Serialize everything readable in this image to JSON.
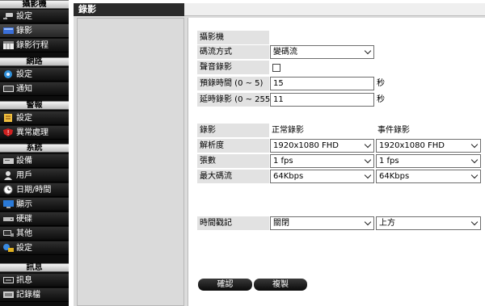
{
  "sidebar": {
    "sections": [
      {
        "title": "攝影機",
        "items": [
          {
            "label": "設定",
            "icon": "camera-icon"
          },
          {
            "label": "錄影",
            "icon": "record-icon"
          },
          {
            "label": "錄影行程",
            "icon": "calendar-icon"
          }
        ]
      },
      {
        "title": "網路",
        "items": [
          {
            "label": "設定",
            "icon": "network-icon"
          },
          {
            "label": "通知",
            "icon": "notify-icon"
          }
        ]
      },
      {
        "title": "警報",
        "items": [
          {
            "label": "設定",
            "icon": "alarm-icon"
          },
          {
            "label": "異常處理",
            "icon": "shield-icon"
          }
        ]
      },
      {
        "title": "系統",
        "items": [
          {
            "label": "設備",
            "icon": "device-icon"
          },
          {
            "label": "用戶",
            "icon": "user-icon"
          },
          {
            "label": "日期/時間",
            "icon": "clock-icon"
          },
          {
            "label": "顯示",
            "icon": "monitor-icon"
          },
          {
            "label": "硬碟",
            "icon": "hdd-icon"
          },
          {
            "label": "其他",
            "icon": "other-icon"
          },
          {
            "label": "設定",
            "icon": "settings-icon"
          }
        ]
      },
      {
        "title": "訊息",
        "items": [
          {
            "label": "訊息",
            "icon": "info-icon"
          },
          {
            "label": "記錄檔",
            "icon": "log-icon"
          }
        ]
      }
    ]
  },
  "header": {
    "title": "錄影"
  },
  "form": {
    "camera_label": "攝影機",
    "stream_label": "碼流方式",
    "stream_value": "變碼流",
    "audio_label": "聲音錄影",
    "prerecord_label": "預錄時間 (0 ~ 5)",
    "prerecord_value": "15",
    "prerecord_unit": "秒",
    "postrecord_label": "延時錄影 (0 ~ 255)",
    "postrecord_value": "11",
    "postrecord_unit": "秒",
    "record_label": "錄影",
    "normal_head": "正常錄影",
    "event_head": "事件錄影",
    "resolution_label": "解析度",
    "resolution_normal": "1920x1080 FHD",
    "resolution_event": "1920x1080 FHD",
    "fps_label": "張數",
    "fps_normal": "1 fps",
    "fps_event": "1 fps",
    "bitrate_label": "最大碼流",
    "bitrate_normal": "64Kbps",
    "bitrate_event": "64Kbps",
    "timestamp_label": "時間戳記",
    "timestamp_value": "關閉",
    "timestamp_position": "上方"
  },
  "buttons": {
    "confirm": "確認",
    "copy": "複製"
  }
}
